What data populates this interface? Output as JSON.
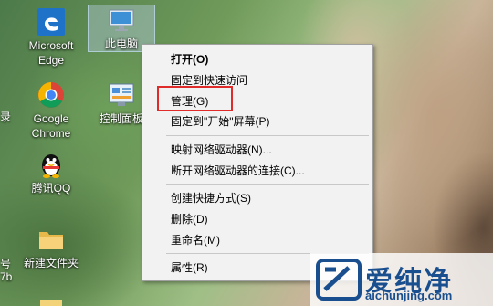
{
  "desktop": {
    "icons": [
      {
        "label_line1": "Microsoft",
        "label_line2": "Edge"
      },
      {
        "label_line1": "此电脑",
        "label_line2": ""
      },
      {
        "label_line1": "Google",
        "label_line2": "Chrome"
      },
      {
        "label_line1": "控制面板",
        "label_line2": ""
      },
      {
        "label_line1": "腾讯QQ",
        "label_line2": ""
      },
      {
        "label_line1": "新建文件夹",
        "label_line2": ""
      }
    ],
    "left_edge_fragments": [
      "录",
      "号",
      "7b"
    ]
  },
  "context_menu": {
    "items": [
      {
        "label": "打开(O)"
      },
      {
        "label": "固定到快速访问"
      },
      {
        "label": "管理(G)"
      },
      {
        "label": "固定到\"开始\"屏幕(P)"
      },
      {
        "label": "映射网络驱动器(N)..."
      },
      {
        "label": "断开网络驱动器的连接(C)..."
      },
      {
        "label": "创建快捷方式(S)"
      },
      {
        "label": "删除(D)"
      },
      {
        "label": "重命名(M)"
      },
      {
        "label": "属性(R)"
      }
    ],
    "highlight_color": "#e02b2b"
  },
  "watermark": {
    "title": "爱纯净",
    "url": "aichunjing.com"
  }
}
